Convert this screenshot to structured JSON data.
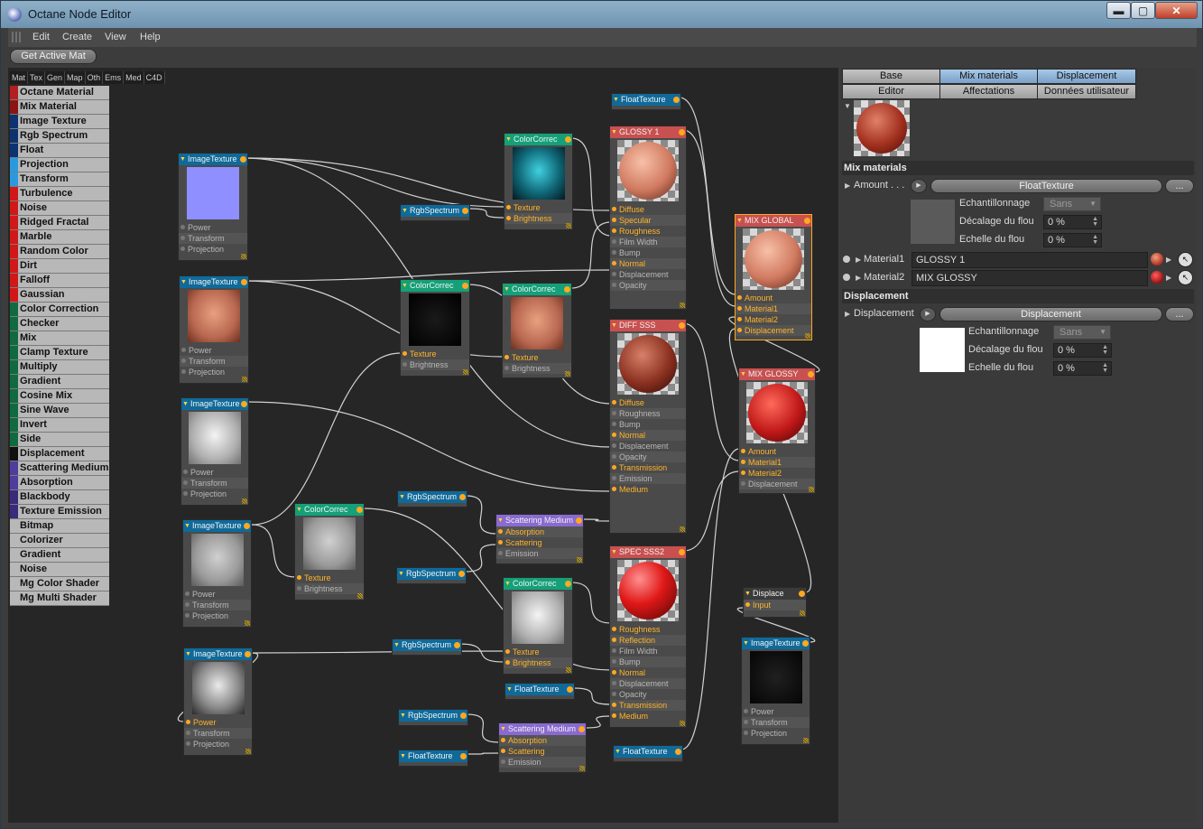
{
  "window": {
    "title": "Octane Node Editor",
    "minimize": "▬",
    "maximize": "▢",
    "close": "✕"
  },
  "menu": [
    "Edit",
    "Create",
    "View",
    "Help"
  ],
  "toolbar": {
    "get_active": "Get Active Mat"
  },
  "palette": {
    "tabs": [
      "Mat",
      "Tex",
      "Gen",
      "Map",
      "Oth",
      "Ems",
      "Med",
      "C4D"
    ],
    "items": [
      {
        "label": "Octane Material",
        "color": "#b41e1e"
      },
      {
        "label": "Mix Material",
        "color": "#8a1414"
      },
      {
        "label": "Image Texture",
        "color": "#0c3270"
      },
      {
        "label": "Rgb Spectrum",
        "color": "#0c3270"
      },
      {
        "label": "Float",
        "color": "#0c3270"
      },
      {
        "label": "Projection",
        "color": "#2a9ae0"
      },
      {
        "label": "Transform",
        "color": "#2a9ae0"
      },
      {
        "label": "Turbulence",
        "color": "#d01818"
      },
      {
        "label": "Noise",
        "color": "#d01818"
      },
      {
        "label": "Ridged Fractal",
        "color": "#d01818"
      },
      {
        "label": "Marble",
        "color": "#d01818"
      },
      {
        "label": "Random Color",
        "color": "#d01818"
      },
      {
        "label": "Dirt",
        "color": "#d01818"
      },
      {
        "label": "Falloff",
        "color": "#d01818"
      },
      {
        "label": "Gaussian Spectrum",
        "color": "#d01818"
      },
      {
        "label": "Color Correction",
        "color": "#106a40"
      },
      {
        "label": "Checker",
        "color": "#106a40"
      },
      {
        "label": "Mix",
        "color": "#106a40"
      },
      {
        "label": "Clamp Texture",
        "color": "#106a40"
      },
      {
        "label": "Multiply",
        "color": "#106a40"
      },
      {
        "label": "Gradient",
        "color": "#106a40"
      },
      {
        "label": "Cosine Mix",
        "color": "#106a40"
      },
      {
        "label": "Sine Wave",
        "color": "#106a40"
      },
      {
        "label": "Invert",
        "color": "#106a40"
      },
      {
        "label": "Side",
        "color": "#106a40"
      },
      {
        "label": "Displacement",
        "color": "#101010"
      },
      {
        "label": "Scattering Medium",
        "color": "#503c9c"
      },
      {
        "label": "Absorption Medium",
        "color": "#503c9c"
      },
      {
        "label": "Blackbody Emission",
        "color": "#3a2a7a"
      },
      {
        "label": "Texture Emission",
        "color": "#3a2a7a"
      },
      {
        "label": "Bitmap",
        "color": "#b8b8b8"
      },
      {
        "label": "Colorizer",
        "color": "#b8b8b8"
      },
      {
        "label": "Gradient",
        "color": "#b8b8b8"
      },
      {
        "label": "Noise",
        "color": "#b8b8b8"
      },
      {
        "label": "Mg Color Shader",
        "color": "#b8b8b8"
      },
      {
        "label": "Mg Multi Shader",
        "color": "#b8b8b8"
      }
    ]
  },
  "colors": {
    "tex": "#0f6a9a",
    "cc": "#14a078",
    "mat": "#c85050",
    "med": "#8a6ad0",
    "disp": "#3a3a3a",
    "wire": "#d2d2d2"
  },
  "nodes": [
    {
      "id": "img1",
      "title": "ImageTexture",
      "kind": "tex",
      "thumb": "#8f8fff",
      "ports": [
        [
          "Power",
          0
        ],
        [
          "Transform",
          0
        ],
        [
          "Projection",
          0
        ]
      ]
    },
    {
      "id": "img2",
      "title": "ImageTexture",
      "kind": "tex",
      "thumb": "face-skin",
      "ports": [
        [
          "Power",
          0
        ],
        [
          "Transform",
          0
        ],
        [
          "Projection",
          0
        ]
      ]
    },
    {
      "id": "img3",
      "title": "ImageTexture",
      "kind": "tex",
      "thumb": "face-white",
      "ports": [
        [
          "Power",
          0
        ],
        [
          "Transform",
          0
        ],
        [
          "Projection",
          0
        ]
      ]
    },
    {
      "id": "img4",
      "title": "ImageTexture",
      "kind": "tex",
      "thumb": "face-grey",
      "ports": [
        [
          "Power",
          0
        ],
        [
          "Transform",
          0
        ],
        [
          "Projection",
          0
        ]
      ]
    },
    {
      "id": "img5",
      "title": "ImageTexture",
      "kind": "tex",
      "thumb": "face-bw",
      "ports": [
        [
          "Power",
          1
        ],
        [
          "Transform",
          0
        ],
        [
          "Projection",
          0
        ]
      ]
    },
    {
      "id": "cc1",
      "title": "ColorCorrec",
      "kind": "cc",
      "thumb": "face-cyan",
      "ports": [
        [
          "Texture",
          1
        ],
        [
          "Brightness",
          1
        ]
      ]
    },
    {
      "id": "cc2",
      "title": "ColorCorrec",
      "kind": "cc",
      "thumb": "dark",
      "ports": [
        [
          "Texture",
          1
        ],
        [
          "Brightness",
          0
        ]
      ]
    },
    {
      "id": "cc3",
      "title": "ColorCorrec",
      "kind": "cc",
      "thumb": "face-skin",
      "ports": [
        [
          "Texture",
          1
        ],
        [
          "Brightness",
          0
        ]
      ]
    },
    {
      "id": "cc4",
      "title": "ColorCorrec",
      "kind": "cc",
      "thumb": "face-grey",
      "ports": [
        [
          "Texture",
          1
        ],
        [
          "Brightness",
          0
        ]
      ]
    },
    {
      "id": "cc5",
      "title": "ColorCorrec",
      "kind": "cc",
      "thumb": "face-white",
      "ports": [
        [
          "Texture",
          1
        ],
        [
          "Brightness",
          1
        ]
      ]
    },
    {
      "id": "rgb1",
      "title": "RgbSpectrum",
      "kind": "tex",
      "ports": []
    },
    {
      "id": "rgb2",
      "title": "RgbSpectrum",
      "kind": "tex",
      "ports": []
    },
    {
      "id": "rgb3",
      "title": "RgbSpectrum",
      "kind": "tex",
      "ports": []
    },
    {
      "id": "rgb4",
      "title": "RgbSpectrum",
      "kind": "tex",
      "ports": []
    },
    {
      "id": "rgb5",
      "title": "RgbSpectrum",
      "kind": "tex",
      "ports": []
    },
    {
      "id": "ft1",
      "title": "FloatTexture",
      "kind": "tex",
      "ports": []
    },
    {
      "id": "ft2",
      "title": "FloatTexture",
      "kind": "tex",
      "ports": []
    },
    {
      "id": "ft3",
      "title": "FloatTexture",
      "kind": "tex",
      "ports": []
    },
    {
      "id": "ft4",
      "title": "FloatTexture",
      "kind": "tex",
      "ports": []
    },
    {
      "id": "sm1",
      "title": "Scattering Medium",
      "kind": "med",
      "ports": [
        [
          "Absorption",
          1
        ],
        [
          "Scattering",
          1
        ],
        [
          "Emission",
          0
        ]
      ]
    },
    {
      "id": "sm2",
      "title": "Scattering Medium",
      "kind": "med",
      "ports": [
        [
          "Absorption",
          1
        ],
        [
          "Scattering",
          1
        ],
        [
          "Emission",
          0
        ]
      ]
    },
    {
      "id": "glossy",
      "title": "GLOSSY 1",
      "kind": "mat",
      "thumb": "ball-skin",
      "ports": [
        [
          "Diffuse",
          1
        ],
        [
          "Specular",
          1
        ],
        [
          "Roughness",
          1
        ],
        [
          "Film Width",
          0
        ],
        [
          "Bump",
          0
        ],
        [
          "Normal",
          1
        ],
        [
          "Displacement",
          0
        ],
        [
          "Opacity",
          0
        ]
      ]
    },
    {
      "id": "diff",
      "title": "DIFF SSS",
      "kind": "mat",
      "thumb": "ball-dark",
      "ports": [
        [
          "Diffuse",
          1
        ],
        [
          "Roughness",
          0
        ],
        [
          "Bump",
          0
        ],
        [
          "Normal",
          1
        ],
        [
          "Displacement",
          0
        ],
        [
          "Opacity",
          0
        ],
        [
          "Transmission",
          1
        ],
        [
          "Emission",
          0
        ],
        [
          "Medium",
          1
        ]
      ]
    },
    {
      "id": "spec",
      "title": "SPEC SSS2",
      "kind": "mat",
      "thumb": "ball-red",
      "ports": [
        [
          "Roughness",
          1
        ],
        [
          "Reflection",
          1
        ],
        [
          "Film Width",
          0
        ],
        [
          "Bump",
          0
        ],
        [
          "Normal",
          1
        ],
        [
          "Displacement",
          0
        ],
        [
          "Opacity",
          0
        ],
        [
          "Transmission",
          1
        ],
        [
          "Medium",
          1
        ]
      ]
    },
    {
      "id": "mixg",
      "title": "MIX GLOBAL",
      "kind": "mat",
      "thumb": "ball-skin",
      "ports": [
        [
          "Amount",
          1
        ],
        [
          "Material1",
          1
        ],
        [
          "Material2",
          1
        ],
        [
          "Displacement",
          1
        ]
      ]
    },
    {
      "id": "mixgl",
      "title": "MIX GLOSSY",
      "kind": "mat",
      "thumb": "ball-red2",
      "ports": [
        [
          "Amount",
          1
        ],
        [
          "Material1",
          1
        ],
        [
          "Material2",
          1
        ],
        [
          "Displacement",
          0
        ]
      ]
    },
    {
      "id": "disp",
      "title": "Displace",
      "kind": "disp",
      "ports": [
        [
          "Input",
          1
        ]
      ]
    },
    {
      "id": "img6",
      "title": "ImageTexture",
      "kind": "tex",
      "thumb": "black",
      "ports": [
        [
          "Power",
          0
        ],
        [
          "Transform",
          0
        ],
        [
          "Projection",
          0
        ]
      ]
    }
  ],
  "props": {
    "tabs_row1": [
      {
        "label": "Base",
        "sel": false
      },
      {
        "label": "Mix materials",
        "sel": true
      },
      {
        "label": "Displacement",
        "sel": true
      }
    ],
    "tabs_row2": [
      {
        "label": "Editor",
        "sel": false
      },
      {
        "label": "Affectations",
        "sel": false
      },
      {
        "label": "Données utilisateur",
        "sel": false
      }
    ],
    "mix": {
      "section": "Mix materials",
      "amount_label": "Amount . . .",
      "amount_btn": "FloatTexture",
      "more": "...",
      "sampling_label": "Echantillonnage",
      "sampling_value": "Sans",
      "blur_offset_label": "Décalage du flou",
      "blur_offset_value": "0 %",
      "blur_scale_label": "Echelle du flou",
      "blur_scale_value": "0 %",
      "material1_label": "Material1",
      "material1_value": "GLOSSY 1",
      "material2_label": "Material2",
      "material2_value": "MIX GLOSSY",
      "preview_color": "#5a5a5a"
    },
    "disp": {
      "section": "Displacement",
      "label": "Displacement",
      "btn": "Displacement",
      "more": "...",
      "sampling_label": "Echantillonnage",
      "sampling_value": "Sans",
      "blur_offset_label": "Décalage du flou",
      "blur_offset_value": "0 %",
      "blur_scale_label": "Echelle du flou",
      "blur_scale_value": "0 %",
      "preview_color": "#ffffff"
    }
  }
}
